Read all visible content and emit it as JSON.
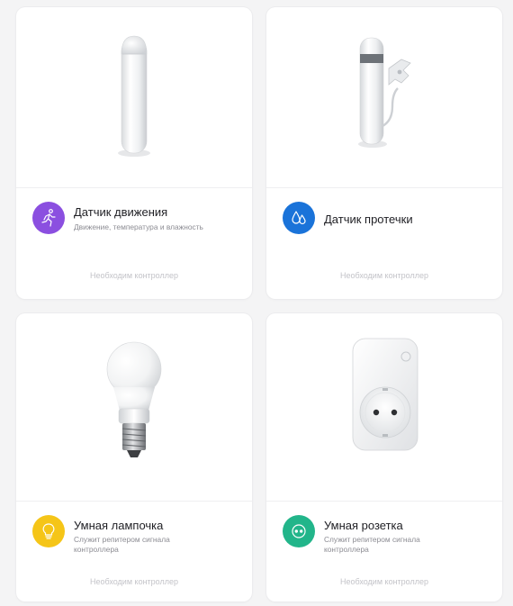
{
  "products": [
    {
      "title": "Датчик движения",
      "subtitle": "Движение, температура и влажность",
      "footer": "Необходим контроллер",
      "icon": "running-man-icon",
      "color": "#8b4fe0"
    },
    {
      "title": "Датчик протечки",
      "subtitle": "",
      "footer": "Необходим контроллер",
      "icon": "water-drops-icon",
      "color": "#1a73d9"
    },
    {
      "title": "Умная лампочка",
      "subtitle": "Служит репитером сигнала контроллера",
      "footer": "Необходим контроллер",
      "icon": "lightbulb-icon",
      "color": "#f5c518"
    },
    {
      "title": "Умная розетка",
      "subtitle": "Служит репитером сигнала контроллера",
      "footer": "Необходим контроллер",
      "icon": "socket-icon",
      "color": "#22b58a"
    }
  ]
}
